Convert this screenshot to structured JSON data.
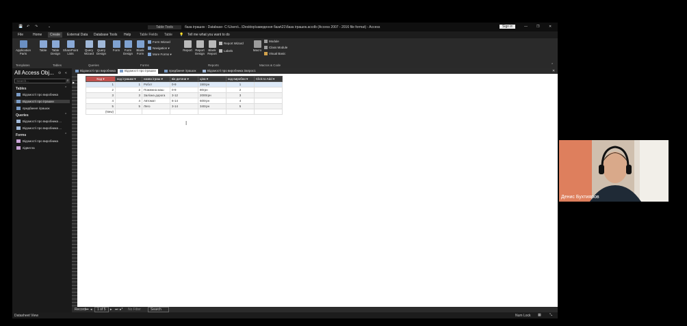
{
  "titlebar": {
    "context_label": "Table Tools",
    "title": "база іграшок : Database- C:\\Users\\...\\Desktop\\заведення бази\\21\\база іграшок.accdb (Access 2007 - 2016 file format) - Access",
    "signin": "Sign in"
  },
  "ribbon_tabs": [
    "File",
    "Home",
    "Create",
    "External Data",
    "Database Tools",
    "Help",
    "Table Fields",
    "Table"
  ],
  "tell_me": "Tell me what you want to do",
  "ribbon": {
    "templates": {
      "label": "Templates",
      "buttons": [
        "Application Parts"
      ]
    },
    "tables": {
      "label": "Tables",
      "buttons": [
        "Table",
        "Table Design",
        "SharePoint Lists"
      ]
    },
    "queries": {
      "label": "Queries",
      "buttons": [
        "Query Wizard",
        "Query Design"
      ]
    },
    "forms": {
      "label": "Forms",
      "buttons": [
        "Form",
        "Form Design",
        "Blank Form"
      ],
      "small": [
        "Form Wizard",
        "Navigation",
        "More Forms"
      ]
    },
    "reports": {
      "label": "Reports",
      "buttons": [
        "Report",
        "Report Design",
        "Blank Report"
      ],
      "small": [
        "Report Wizard",
        "Labels"
      ]
    },
    "macros": {
      "label": "Macros & Code",
      "buttons": [
        "Macro"
      ],
      "small": [
        "Module",
        "Class Module",
        "Visual Basic"
      ]
    }
  },
  "nav": {
    "title": "All Access Obj...",
    "search_placeholder": "Search...",
    "groups": [
      {
        "name": "Tables",
        "items": [
          "Відомості про виробника",
          "Відомості про іграшки",
          "придбання іграшок"
        ]
      },
      {
        "name": "Queries",
        "items": [
          "Відомості про виробника ...",
          "Відомості про виробника ..."
        ]
      },
      {
        "name": "Forms",
        "items": [
          "Відомості про виробника",
          "підвегла"
        ]
      }
    ]
  },
  "doc_tabs": [
    "Відомості про виробника",
    "Відомості про іграшки",
    "придбання іграшок",
    "Відомості про виробника Запрос1"
  ],
  "table": {
    "columns": [
      "Код",
      "код іграшки",
      "назва іграш",
      "вік дитини",
      "ціна",
      "код виробни",
      "Click to Add"
    ],
    "rows": [
      [
        "1",
        "1",
        "Робот",
        "0-9",
        "150грн",
        "1"
      ],
      [
        "2",
        "2",
        "Пожежна маш",
        "0-9",
        "80грн",
        "2"
      ],
      [
        "3",
        "3",
        "Залізна дорога",
        "3-12",
        "2000грн",
        "3"
      ],
      [
        "4",
        "4",
        "Автомат",
        "6-14",
        "600грн",
        "4"
      ],
      [
        "5",
        "5",
        "Лего",
        "3-14",
        "340грн",
        "5"
      ]
    ],
    "new_row_label": "(New)"
  },
  "record_nav": {
    "label": "Record:",
    "position": "1 of 5",
    "filter": "No Filter",
    "search": "Search"
  },
  "status": {
    "left": "Datasheet View",
    "numlock": "Num Lock"
  },
  "webcam": {
    "name": "Денис Бухтияров"
  }
}
